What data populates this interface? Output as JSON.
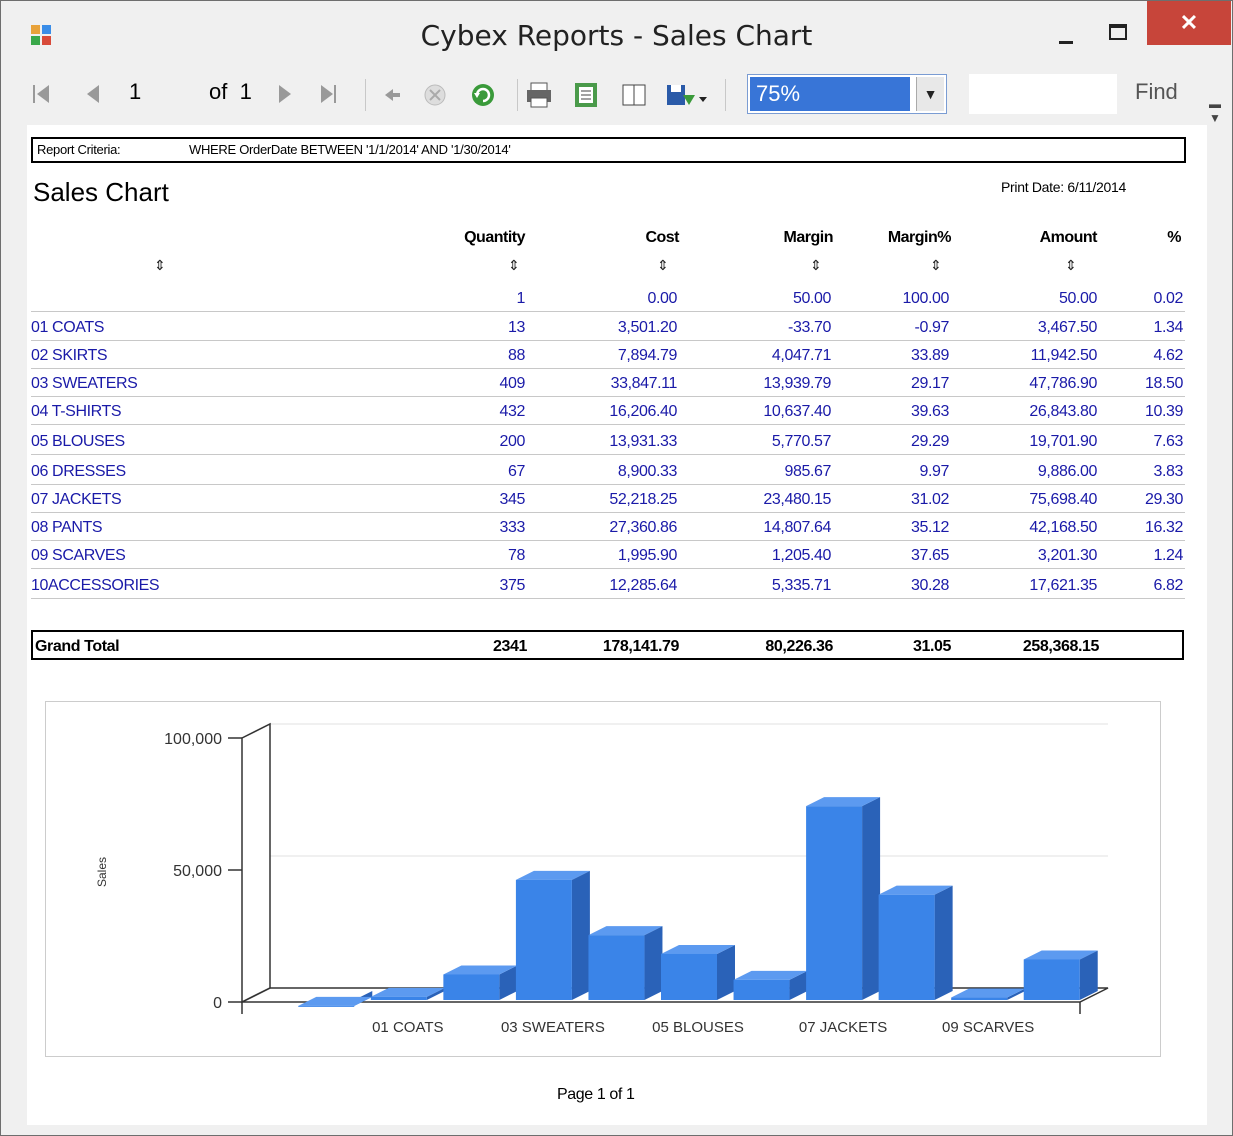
{
  "window": {
    "title": "Cybex Reports - Sales Chart",
    "close_label": "✕"
  },
  "toolbar": {
    "page_current": "1",
    "page_of": "of",
    "page_total": "1",
    "zoom": "75%",
    "find_label": "Find"
  },
  "report": {
    "criteria_label": "Report Criteria:",
    "criteria_text": "WHERE OrderDate BETWEEN '1/1/2014' AND '1/30/2014'",
    "title": "Sales Chart",
    "print_date": "Print Date: 6/11/2014",
    "columns": [
      "Quantity",
      "Cost",
      "Margin",
      "Margin%",
      "Amount",
      "%"
    ],
    "rows": [
      {
        "name": "",
        "quantity": "1",
        "cost": "0.00",
        "margin": "50.00",
        "margin_pct": "100.00",
        "amount": "50.00",
        "pct": "0.02"
      },
      {
        "name": "01 COATS",
        "quantity": "13",
        "cost": "3,501.20",
        "margin": "-33.70",
        "margin_pct": "-0.97",
        "amount": "3,467.50",
        "pct": "1.34"
      },
      {
        "name": "02 SKIRTS",
        "quantity": "88",
        "cost": "7,894.79",
        "margin": "4,047.71",
        "margin_pct": "33.89",
        "amount": "11,942.50",
        "pct": "4.62"
      },
      {
        "name": "03 SWEATERS",
        "quantity": "409",
        "cost": "33,847.11",
        "margin": "13,939.79",
        "margin_pct": "29.17",
        "amount": "47,786.90",
        "pct": "18.50"
      },
      {
        "name": "04 T-SHIRTS",
        "quantity": "432",
        "cost": "16,206.40",
        "margin": "10,637.40",
        "margin_pct": "39.63",
        "amount": "26,843.80",
        "pct": "10.39"
      },
      {
        "name": "05 BLOUSES",
        "quantity": "200",
        "cost": "13,931.33",
        "margin": "5,770.57",
        "margin_pct": "29.29",
        "amount": "19,701.90",
        "pct": "7.63"
      },
      {
        "name": "06 DRESSES",
        "quantity": "67",
        "cost": "8,900.33",
        "margin": "985.67",
        "margin_pct": "9.97",
        "amount": "9,886.00",
        "pct": "3.83"
      },
      {
        "name": "07 JACKETS",
        "quantity": "345",
        "cost": "52,218.25",
        "margin": "23,480.15",
        "margin_pct": "31.02",
        "amount": "75,698.40",
        "pct": "29.30"
      },
      {
        "name": "08 PANTS",
        "quantity": "333",
        "cost": "27,360.86",
        "margin": "14,807.64",
        "margin_pct": "35.12",
        "amount": "42,168.50",
        "pct": "16.32"
      },
      {
        "name": "09 SCARVES",
        "quantity": "78",
        "cost": "1,995.90",
        "margin": "1,205.40",
        "margin_pct": "37.65",
        "amount": "3,201.30",
        "pct": "1.24"
      },
      {
        "name": "10ACCESSORIES",
        "quantity": "375",
        "cost": "12,285.64",
        "margin": "5,335.71",
        "margin_pct": "30.28",
        "amount": "17,621.35",
        "pct": "6.82"
      }
    ],
    "grand_total": {
      "label": "Grand Total",
      "quantity": "2341",
      "cost": "178,141.79",
      "margin": "80,226.36",
      "margin_pct": "31.05",
      "amount": "258,368.15"
    },
    "footer": "Page 1 of 1"
  },
  "chart_data": {
    "type": "bar",
    "categories": [
      "",
      "01 COATS",
      "02 SKIRTS",
      "03 SWEATERS",
      "04 T-SHIRTS",
      "05 BLOUSES",
      "06 DRESSES",
      "07 JACKETS",
      "08 PANTS",
      "09 SCARVES",
      "10ACCESSORIES"
    ],
    "x_tick_labels": [
      "01 COATS",
      "03 SWEATERS",
      "05 BLOUSES",
      "07 JACKETS",
      "09 SCARVES"
    ],
    "values": [
      50.0,
      3467.5,
      11942.5,
      47786.9,
      26843.8,
      19701.9,
      9886.0,
      75698.4,
      42168.5,
      3201.3,
      17621.35
    ],
    "ylabel": "Sales",
    "yticks": [
      "0",
      "50,000",
      "100,000"
    ],
    "ylim": [
      0,
      100000
    ],
    "bar_color": "#3a84e8",
    "bar_side_color": "#2a62b8",
    "bar_top_color": "#5c9af0"
  }
}
